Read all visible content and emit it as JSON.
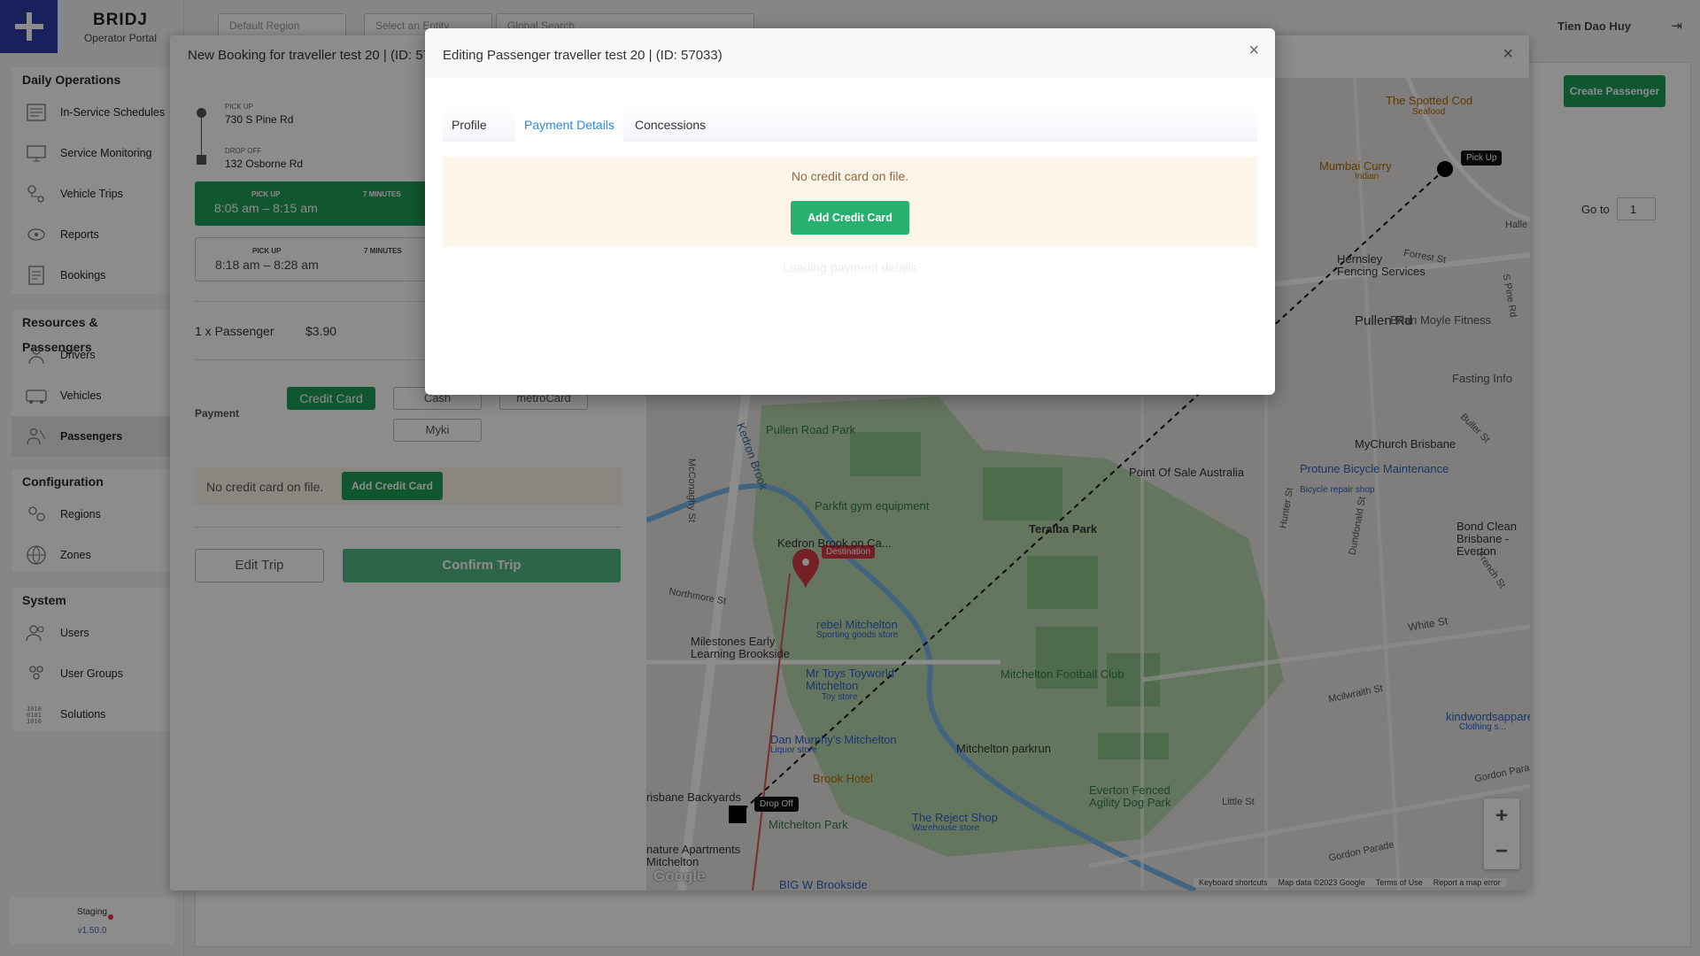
{
  "app": {
    "brand": "BRIDJ",
    "subtitle": "Operator Portal",
    "user": "Tien Dao Huy",
    "env": "Staging",
    "version": "v1.50.0"
  },
  "topbar": {
    "region": "Default Region",
    "entity": "Select an Entity",
    "search": "Global Search"
  },
  "sidebar": {
    "groups": [
      {
        "title": "Daily Operations",
        "items": [
          "In-Service Schedules",
          "Service Monitoring",
          "Vehicle Trips",
          "Reports",
          "Bookings"
        ]
      },
      {
        "title": "Resources & Passengers",
        "items": [
          "Drivers",
          "Vehicles",
          "Passengers"
        ]
      },
      {
        "title": "Configuration",
        "items": [
          "Regions",
          "Zones"
        ]
      },
      {
        "title": "System",
        "items": [
          "Users",
          "User Groups",
          "Solutions"
        ]
      }
    ]
  },
  "booking": {
    "title": "New Booking for traveller test 20 | (ID: 57033)",
    "pickup_label": "PICK UP",
    "pickup": "730 S Pine Rd",
    "dropoff_label": "DROP OFF",
    "dropoff": "132 Osborne Rd",
    "slot1": {
      "label": "PICK UP",
      "time": "8:05 am – 8:15 am",
      "duration": "7 MINUTES"
    },
    "slot2": {
      "label": "PICK UP",
      "time": "8:18 am – 8:28 am",
      "duration": "7 MINUTES"
    },
    "passengers": "1 x Passenger",
    "price": "$3.90",
    "payment_label": "Payment",
    "payment_methods": [
      "Credit Card",
      "Cash",
      "metroCard",
      "Myki"
    ],
    "no_card": "No credit card on file.",
    "add_card": "Add Credit Card",
    "edit_trip": "Edit Trip",
    "confirm_trip": "Confirm Trip",
    "create_passenger": "Create Passenger",
    "goto": "Go to",
    "goto_value": "1"
  },
  "map": {
    "pickup_tag": "Pick Up",
    "dropoff_tag": "Drop Off",
    "destination_tag": "Destination",
    "zoom_in": "+",
    "zoom_out": "−",
    "footer": [
      "Keyboard shortcuts",
      "Map data ©2023 Google",
      "Terms of Use",
      "Report a map error"
    ],
    "google": "Google",
    "labels": [
      "The Spotted Cod",
      "Seafood",
      "Mumbai Curry",
      "Indian",
      "Hernsley Fencing Services",
      "Pullen Rd",
      "Brian Moyle Fitness",
      "Fasting Info",
      "Pullen Road Park",
      "Parkfit gym equipment",
      "Kedron Brook",
      "MyChurch Brisbane",
      "Point Of Sale Australia",
      "Protune Bicycle Maintenance",
      "Bicycle repair shop",
      "Teralba Park",
      "Bond Clean Brisbane - Everton",
      "Kedron Brook on Ca...",
      "rebel Mitchelton",
      "Sporting goods store",
      "Milestones Early Learning Brookside",
      "Mr Toys Toyworld Mitchelton",
      "Toy store",
      "Mitchelton Football Club",
      "White St",
      "kindwordsapparel",
      "Clothing s...",
      "Dan Murphy's Mitchelton",
      "Liquor store",
      "Mitchelton parkrun",
      "Brook Hotel",
      "Everton Fenced Agility Dog Park",
      "Mitchelton Park",
      "The Reject Shop",
      "Warehouse store",
      "Gordon Parade",
      "Little St",
      "BIG W Brookside",
      "risbane Backyards",
      "nature Apartments Mitchelton",
      "Northmore St",
      "McConaghy St",
      "Forrest St",
      "S Pine Rd",
      "Hunter St",
      "Dundonald St",
      "Buller St",
      "French St",
      "Mcilwraith St",
      "Gordon Para",
      "Halle"
    ]
  },
  "dialog": {
    "title": "Editing Passenger traveller test 20 | (ID: 57033)",
    "tabs": [
      "Profile",
      "Payment Details",
      "Concessions"
    ],
    "active_tab": "Payment Details",
    "no_card": "No credit card on file.",
    "add_card": "Add Credit Card",
    "loading": "Loading payment details"
  }
}
